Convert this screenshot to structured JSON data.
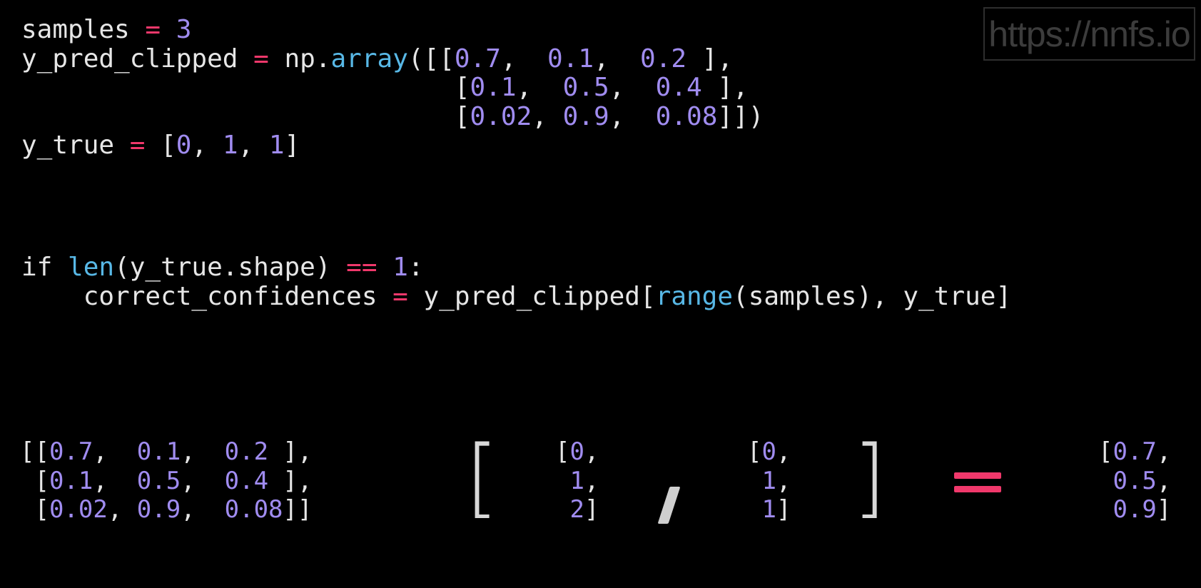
{
  "watermark": "https://nnfs.io",
  "code_top": {
    "line1": {
      "var": "samples ",
      "op": "=",
      "sp": " ",
      "num": "3"
    },
    "line2": {
      "var": "y_pred_clipped ",
      "op": "=",
      "pre": " np.",
      "fn": "array",
      "open": "([[",
      "n1": "0.7",
      "c1": ",  ",
      "n2": "0.1",
      "c2": ",  ",
      "n3": "0.2",
      "close": " ],"
    },
    "line3": {
      "indent": "                            [",
      "n1": "0.1",
      "c1": ",  ",
      "n2": "0.5",
      "c2": ",  ",
      "n3": "0.4",
      "close": " ],"
    },
    "line4": {
      "indent": "                            [",
      "n1": "0.02",
      "c1": ", ",
      "n2": "0.9",
      "c2": ",  ",
      "n3": "0.08",
      "close": "]])"
    },
    "line5": {
      "var": "y_true ",
      "op": "=",
      "open": " [",
      "n1": "0",
      "c1": ", ",
      "n2": "1",
      "c2": ", ",
      "n3": "1",
      "close": "]"
    }
  },
  "code_if": {
    "line1": {
      "kw": "if ",
      "fn": "len",
      "mid": "(y_true.shape) ",
      "op": "==",
      "sp": " ",
      "num": "1",
      "end": ":"
    },
    "line2": {
      "indent": "    correct_confidences ",
      "op": "=",
      "mid": " y_pred_clipped[",
      "fn": "range",
      "end": "(samples), y_true]"
    }
  },
  "matrix_left": {
    "r1": {
      "open": "[[",
      "a": "0.7",
      "c1": ",  ",
      "b": "0.1",
      "c2": ",  ",
      "c": "0.2",
      "close": " ],"
    },
    "r2": {
      "open": " [",
      "a": "0.1",
      "c1": ",  ",
      "b": "0.5",
      "c2": ",  ",
      "c": "0.4",
      "close": " ],"
    },
    "r3": {
      "open": " [",
      "a": "0.02",
      "c1": ", ",
      "b": "0.9",
      "c2": ",  ",
      "c": "0.08",
      "close": "]]"
    }
  },
  "index_a": {
    "r1": {
      "open": "[",
      "v": "0",
      "close": ","
    },
    "r2": {
      "open": " ",
      "v": "1",
      "close": ","
    },
    "r3": {
      "open": " ",
      "v": "2",
      "close": "]"
    }
  },
  "index_b": {
    "r1": {
      "open": "[",
      "v": "0",
      "close": ","
    },
    "r2": {
      "open": " ",
      "v": "1",
      "close": ","
    },
    "r3": {
      "open": " ",
      "v": "1",
      "close": "]"
    }
  },
  "result": {
    "r1": {
      "open": "[",
      "v": "0.7",
      "close": ","
    },
    "r2": {
      "open": " ",
      "v": "0.5",
      "close": ","
    },
    "r3": {
      "open": " ",
      "v": "0.9",
      "close": "]"
    }
  },
  "colors": {
    "operator": "#f0386b",
    "number": "#a08cf0",
    "function": "#58b8e6",
    "text": "#e6e6e6",
    "background": "#000000"
  }
}
